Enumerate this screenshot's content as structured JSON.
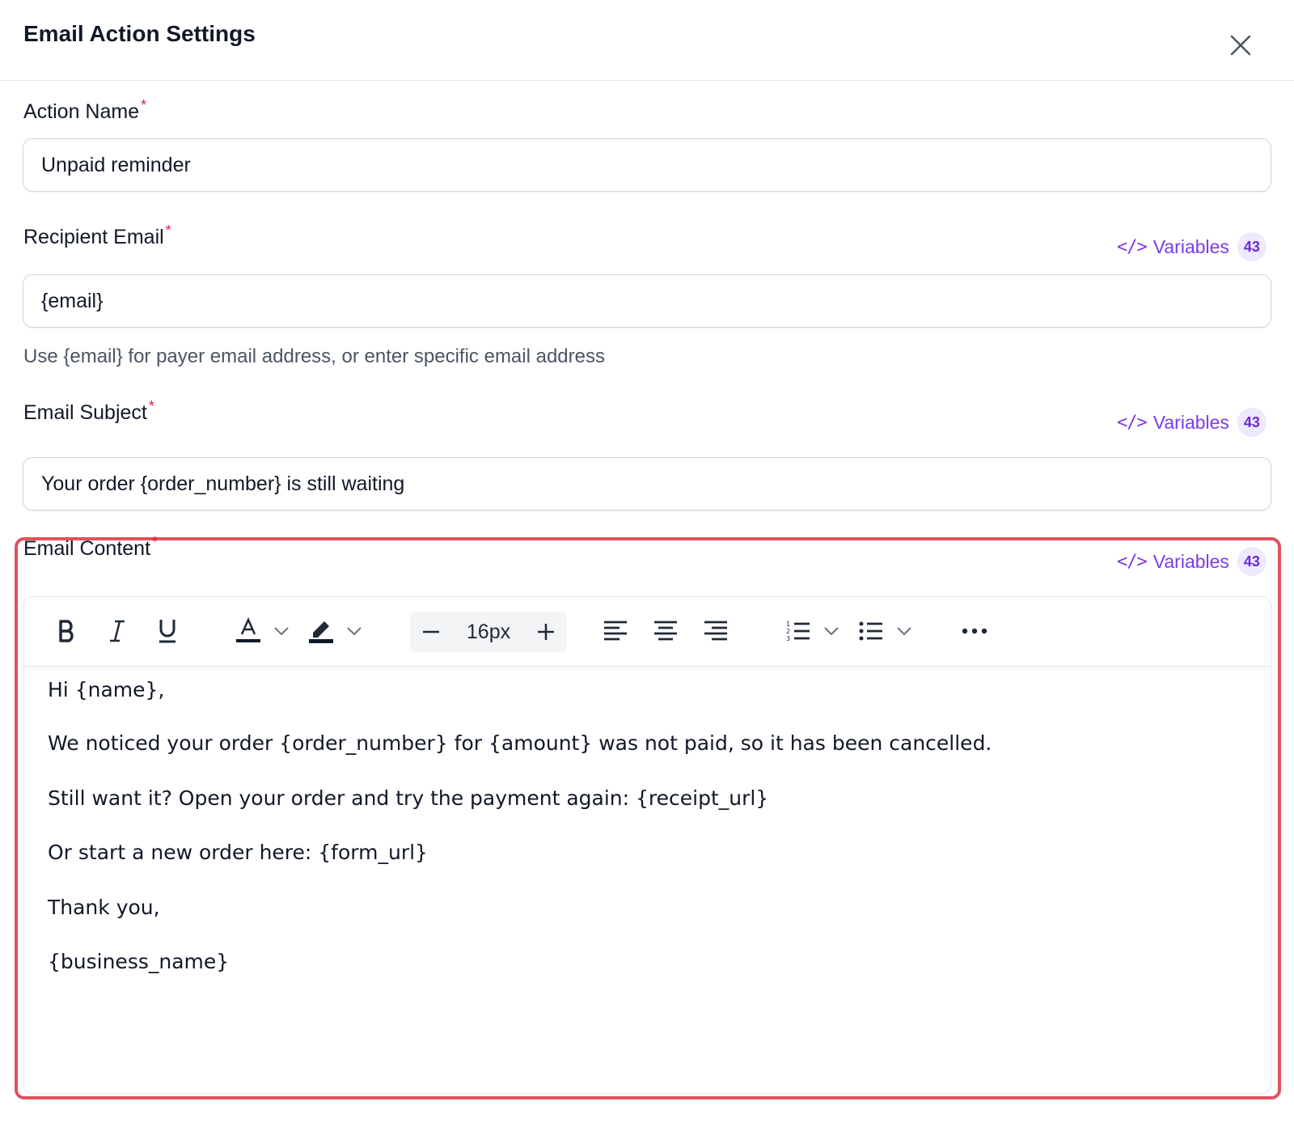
{
  "dialog": {
    "title": "Email Action Settings",
    "close_icon": "close-icon"
  },
  "action_name": {
    "label": "Action Name",
    "required_mark": "*",
    "value": "Unpaid reminder"
  },
  "recipient_email": {
    "label": "Recipient Email",
    "required_mark": "*",
    "value": "{email}",
    "hint": "Use {email} for payer email address, or enter specific email address",
    "variables_label": "Variables",
    "variables_count": "43",
    "variables_icon": "</>"
  },
  "email_subject": {
    "label": "Email Subject",
    "required_mark": "*",
    "value": "Your order {order_number} is still waiting",
    "variables_label": "Variables",
    "variables_count": "43",
    "variables_icon": "</>"
  },
  "email_content": {
    "label": "Email Content",
    "required_mark": "*",
    "variables_label": "Variables",
    "variables_count": "43",
    "variables_icon": "</>",
    "toolbar": {
      "font_size": "16px",
      "icons": [
        "bold-icon",
        "italic-icon",
        "underline-icon",
        "text-color-icon",
        "highlight-icon",
        "minus-icon",
        "plus-icon",
        "align-left-icon",
        "align-center-icon",
        "align-right-icon",
        "ordered-list-icon",
        "bullet-list-icon",
        "more-icon"
      ]
    },
    "body_lines": [
      "Hi {name},",
      "We noticed your order {order_number} for {amount} was not paid, so it has been cancelled.",
      "Still want it? Open your order and try the payment again: {receipt_url}",
      "Or start a new order here: {form_url}",
      "Thank you,",
      "{business_name}"
    ]
  },
  "colors": {
    "accent": "#7c3aed",
    "badge_bg": "#ede9fe",
    "required": "#e11d48",
    "highlight_border": "#e0525e"
  }
}
